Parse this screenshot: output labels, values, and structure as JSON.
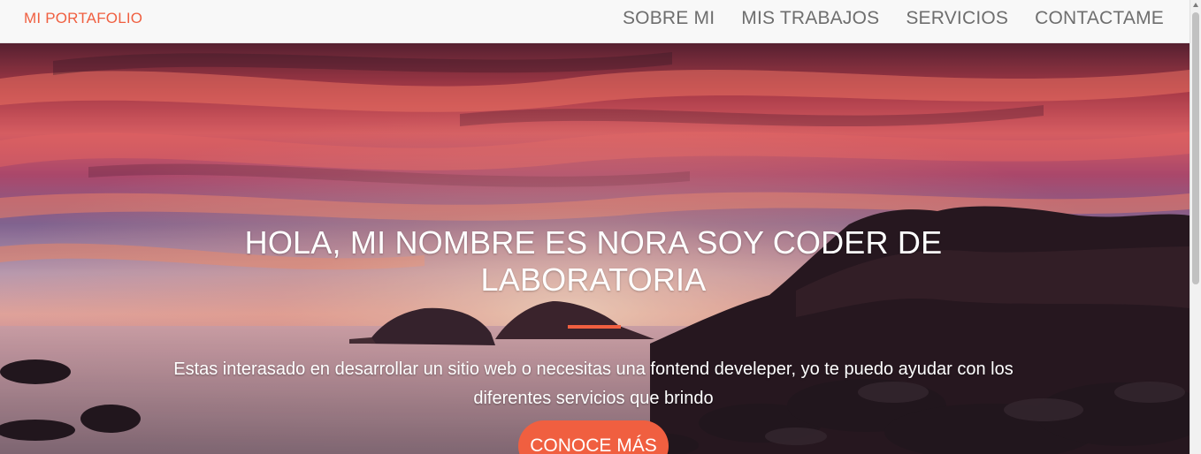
{
  "navbar": {
    "brand": "MI PORTAFOLIO",
    "links": [
      "SOBRE MI",
      "MIS TRABAJOS",
      "SERVICIOS",
      "CONTACTAME"
    ]
  },
  "hero": {
    "title": "HOLA, MI NOMBRE ES NORA SOY CODER DE LABORATORIA",
    "text": "Estas interasado en desarrollar un sitio web o necesitas una fontend develeper, yo te puedo ayudar con los diferentes servicios que brindo",
    "cta_label": "CONOCE MÁS"
  },
  "colors": {
    "accent": "#f05f40",
    "navbar_bg": "#f8f8f8",
    "nav_link": "#6e6e6e"
  }
}
